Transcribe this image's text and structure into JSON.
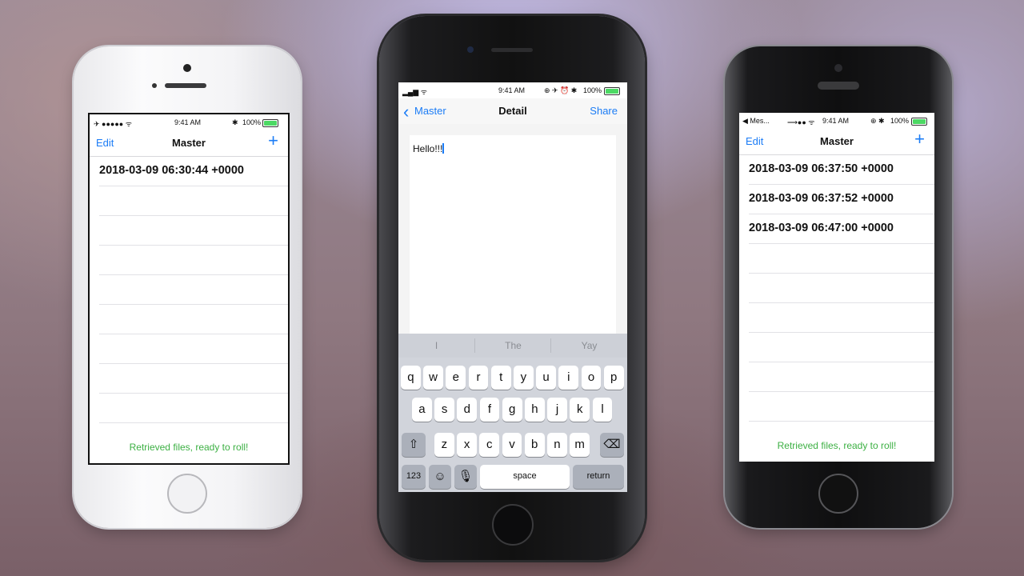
{
  "phones": {
    "left": {
      "status": {
        "carrier": "✈ ●●●●● ᯤ",
        "time": "9:41 AM",
        "battery": "100%"
      },
      "nav": {
        "left": "Edit",
        "title": "Master",
        "right": "+"
      },
      "rows": [
        "2018-03-09 06:30:44 +0000"
      ],
      "footer": "Retrieved files, ready to roll!"
    },
    "middle": {
      "status": {
        "carrier": "▂▄▆ ᯤ",
        "time": "9:41 AM",
        "icons": "⊕ ✈ ⏰ ✱",
        "battery": "100%"
      },
      "nav": {
        "back": "Master",
        "title": "Detail",
        "right": "Share"
      },
      "note_text": "Hello!!!",
      "suggestions": [
        "I",
        "The",
        "Yay"
      ],
      "keyboard": {
        "row1": [
          "q",
          "w",
          "e",
          "r",
          "t",
          "y",
          "u",
          "i",
          "o",
          "p"
        ],
        "row2": [
          "a",
          "s",
          "d",
          "f",
          "g",
          "h",
          "j",
          "k",
          "l"
        ],
        "row3": [
          "z",
          "x",
          "c",
          "v",
          "b",
          "n",
          "m"
        ],
        "num": "123",
        "space": "space",
        "return": "return"
      }
    },
    "right": {
      "status": {
        "back_app": "◀ Mes...",
        "signal": "⟶●● ᯤ",
        "time": "9:41 AM",
        "battery": "100%"
      },
      "nav": {
        "left": "Edit",
        "title": "Master",
        "right": "+"
      },
      "rows": [
        "2018-03-09 06:37:50 +0000",
        "2018-03-09 06:37:52 +0000",
        "2018-03-09 06:47:00 +0000"
      ],
      "footer": "Retrieved files, ready to roll!"
    }
  },
  "colors": {
    "accent": "#1b7cf6",
    "status_green": "#3cb043",
    "battery_green": "#4cd964"
  }
}
